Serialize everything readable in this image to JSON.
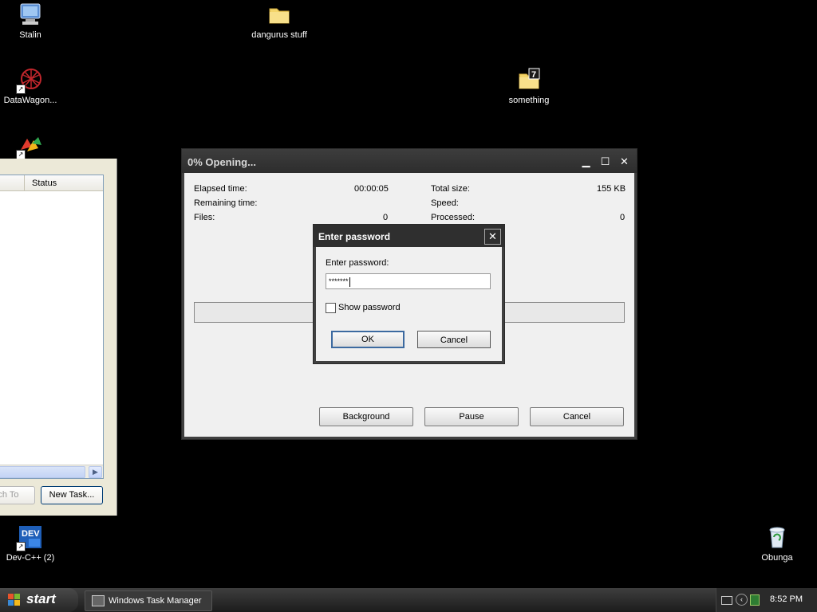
{
  "desktop": {
    "icons": [
      {
        "label": "Stalin",
        "name": "stalin-computer-icon"
      },
      {
        "label": "dangurus stuff",
        "name": "dangurus-folder-icon"
      },
      {
        "label": "DataWagon...",
        "name": "datawagon-icon"
      },
      {
        "label": "something",
        "name": "something-7z-folder-icon"
      },
      {
        "label": "Dev-C++ (2)",
        "name": "devcpp-icon"
      },
      {
        "label": "Obunga",
        "name": "recycle-bin-icon"
      }
    ]
  },
  "task_manager": {
    "column_status": "Status",
    "switch_to_label": "Switch To",
    "new_task_label": "New Task..."
  },
  "progress_window": {
    "title": "0% Opening...",
    "elapsed_label": "Elapsed time:",
    "elapsed_value": "00:00:05",
    "remaining_label": "Remaining time:",
    "files_label": "Files:",
    "files_value": "0",
    "total_size_label": "Total size:",
    "total_size_value": "155 KB",
    "speed_label": "Speed:",
    "processed_label": "Processed:",
    "processed_value": "0",
    "progress": 0,
    "buttons": {
      "background": "Background",
      "pause": "Pause",
      "cancel": "Cancel"
    }
  },
  "password_dialog": {
    "title": "Enter password",
    "prompt": "Enter password:",
    "value": "*******",
    "show_password_label": "Show password",
    "show_password_checked": false,
    "ok_label": "OK",
    "cancel_label": "Cancel"
  },
  "taskbar": {
    "start_label": "start",
    "tasks": [
      {
        "label": "Windows Task Manager"
      }
    ],
    "clock": "8:52 PM"
  }
}
